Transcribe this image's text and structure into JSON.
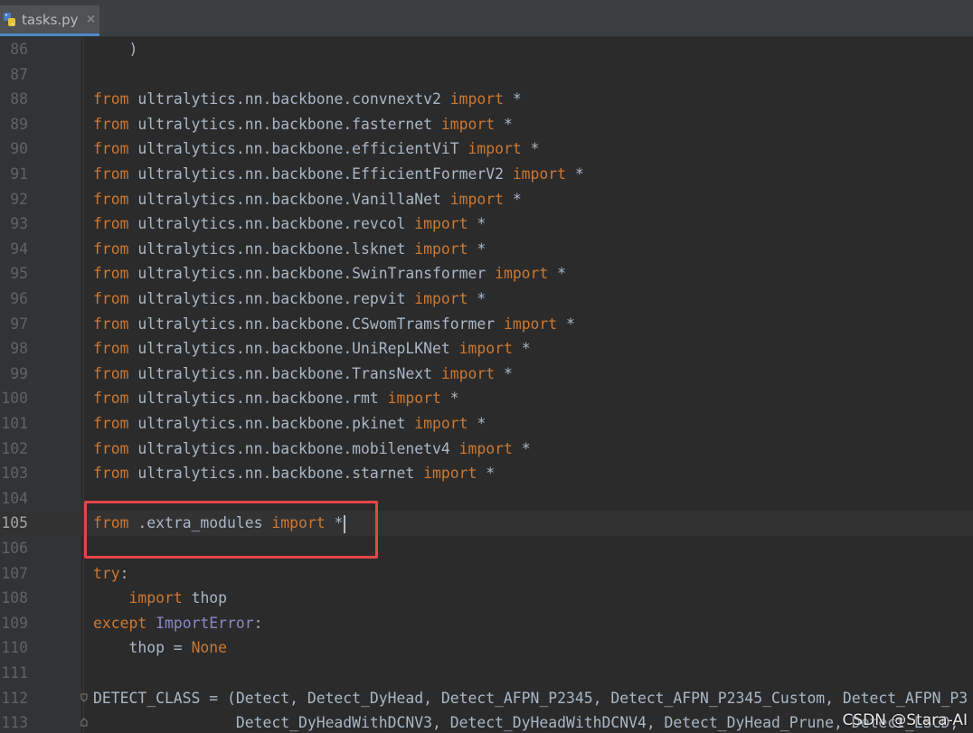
{
  "tab": {
    "filename": "tasks.py",
    "close_glyph": "✕",
    "icon": "python-file-icon"
  },
  "current_line": "105",
  "lines": [
    {
      "n": "86",
      "segs": [
        [
          "t",
          "    )"
        ]
      ]
    },
    {
      "n": "87",
      "segs": []
    },
    {
      "n": "88",
      "segs": [
        [
          "k",
          "from"
        ],
        [
          "t",
          " ultralytics.nn.backbone.convnextv2 "
        ],
        [
          "k",
          "import"
        ],
        [
          "t",
          " *"
        ]
      ]
    },
    {
      "n": "89",
      "segs": [
        [
          "k",
          "from"
        ],
        [
          "t",
          " ultralytics.nn.backbone.fasternet "
        ],
        [
          "k",
          "import"
        ],
        [
          "t",
          " *"
        ]
      ]
    },
    {
      "n": "90",
      "segs": [
        [
          "k",
          "from"
        ],
        [
          "t",
          " ultralytics.nn.backbone.efficientViT "
        ],
        [
          "k",
          "import"
        ],
        [
          "t",
          " *"
        ]
      ]
    },
    {
      "n": "91",
      "segs": [
        [
          "k",
          "from"
        ],
        [
          "t",
          " ultralytics.nn.backbone.EfficientFormerV2 "
        ],
        [
          "k",
          "import"
        ],
        [
          "t",
          " *"
        ]
      ]
    },
    {
      "n": "92",
      "segs": [
        [
          "k",
          "from"
        ],
        [
          "t",
          " ultralytics.nn.backbone.VanillaNet "
        ],
        [
          "k",
          "import"
        ],
        [
          "t",
          " *"
        ]
      ]
    },
    {
      "n": "93",
      "segs": [
        [
          "k",
          "from"
        ],
        [
          "t",
          " ultralytics.nn.backbone.revcol "
        ],
        [
          "k",
          "import"
        ],
        [
          "t",
          " *"
        ]
      ]
    },
    {
      "n": "94",
      "segs": [
        [
          "k",
          "from"
        ],
        [
          "t",
          " ultralytics.nn.backbone.lsknet "
        ],
        [
          "k",
          "import"
        ],
        [
          "t",
          " *"
        ]
      ]
    },
    {
      "n": "95",
      "segs": [
        [
          "k",
          "from"
        ],
        [
          "t",
          " ultralytics.nn.backbone.SwinTransformer "
        ],
        [
          "k",
          "import"
        ],
        [
          "t",
          " *"
        ]
      ]
    },
    {
      "n": "96",
      "segs": [
        [
          "k",
          "from"
        ],
        [
          "t",
          " ultralytics.nn.backbone.repvit "
        ],
        [
          "k",
          "import"
        ],
        [
          "t",
          " *"
        ]
      ]
    },
    {
      "n": "97",
      "segs": [
        [
          "k",
          "from"
        ],
        [
          "t",
          " ultralytics.nn.backbone.CSwomTramsformer "
        ],
        [
          "k",
          "import"
        ],
        [
          "t",
          " *"
        ]
      ]
    },
    {
      "n": "98",
      "segs": [
        [
          "k",
          "from"
        ],
        [
          "t",
          " ultralytics.nn.backbone.UniRepLKNet "
        ],
        [
          "k",
          "import"
        ],
        [
          "t",
          " *"
        ]
      ]
    },
    {
      "n": "99",
      "segs": [
        [
          "k",
          "from"
        ],
        [
          "t",
          " ultralytics.nn.backbone.TransNext "
        ],
        [
          "k",
          "import"
        ],
        [
          "t",
          " *"
        ]
      ]
    },
    {
      "n": "100",
      "segs": [
        [
          "k",
          "from"
        ],
        [
          "t",
          " ultralytics.nn.backbone.rmt "
        ],
        [
          "k",
          "import"
        ],
        [
          "t",
          " *"
        ]
      ]
    },
    {
      "n": "101",
      "segs": [
        [
          "k",
          "from"
        ],
        [
          "t",
          " ultralytics.nn.backbone.pkinet "
        ],
        [
          "k",
          "import"
        ],
        [
          "t",
          " *"
        ]
      ]
    },
    {
      "n": "102",
      "segs": [
        [
          "k",
          "from"
        ],
        [
          "t",
          " ultralytics.nn.backbone.mobilenetv4 "
        ],
        [
          "k",
          "import"
        ],
        [
          "t",
          " *"
        ]
      ]
    },
    {
      "n": "103",
      "segs": [
        [
          "k",
          "from"
        ],
        [
          "t",
          " ultralytics.nn.backbone.starnet "
        ],
        [
          "k",
          "import"
        ],
        [
          "t",
          " *"
        ]
      ]
    },
    {
      "n": "104",
      "segs": []
    },
    {
      "n": "105",
      "segs": [
        [
          "k",
          "from"
        ],
        [
          "t",
          " .extra_modules "
        ],
        [
          "k",
          "import"
        ],
        [
          "t",
          " *"
        ]
      ]
    },
    {
      "n": "106",
      "segs": []
    },
    {
      "n": "107",
      "segs": [
        [
          "k",
          "try"
        ],
        [
          "t",
          ":"
        ]
      ]
    },
    {
      "n": "108",
      "segs": [
        [
          "t",
          "    "
        ],
        [
          "k",
          "import"
        ],
        [
          "t",
          " thop"
        ]
      ]
    },
    {
      "n": "109",
      "segs": [
        [
          "k",
          "except"
        ],
        [
          "t",
          " "
        ],
        [
          "c",
          "ImportError"
        ],
        [
          "t",
          ":"
        ]
      ]
    },
    {
      "n": "110",
      "segs": [
        [
          "t",
          "    thop = "
        ],
        [
          "k",
          "None"
        ]
      ]
    },
    {
      "n": "111",
      "segs": []
    },
    {
      "n": "112",
      "segs": [
        [
          "t",
          "DETECT_CLASS = (Detect, Detect_DyHead, Detect_AFPN_P2345, Detect_AFPN_P2345_Custom, Detect_AFPN_P3"
        ]
      ]
    },
    {
      "n": "113",
      "segs": [
        [
          "t",
          "                Detect_DyHeadWithDCNV3, Detect_DyHeadWithDCNV4, Detect_DyHead_Prune, Detect_LSCD,"
        ]
      ]
    }
  ],
  "watermark": "CSDN @Stara-AI",
  "colors": {
    "background": "#2b2b2b",
    "keyword": "#cc7832",
    "text": "#a9b7c6",
    "builtin_class": "#8888c6",
    "highlight_box": "#e6454a"
  }
}
